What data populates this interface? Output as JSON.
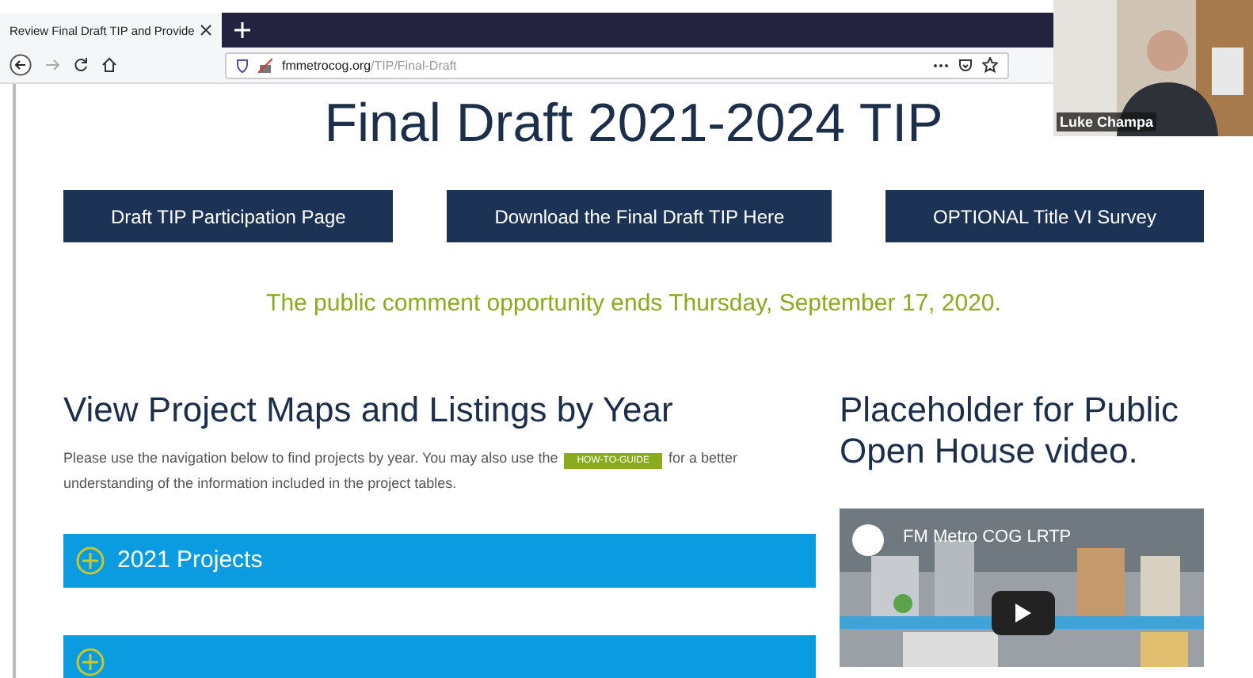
{
  "browser": {
    "tab_title": "Review Final Draft TIP and Provide",
    "url_host": "fmmetrocog.org",
    "url_path": "/TIP/Final-Draft"
  },
  "page": {
    "title": "Final Draft 2021-2024 TIP",
    "buttons": [
      "Draft TIP Participation Page",
      "Download the Final Draft TIP Here",
      "OPTIONAL Title VI Survey"
    ],
    "notice": "The public comment opportunity ends Thursday, September 17, 2020.",
    "listings": {
      "heading": "View Project Maps and Listings by Year",
      "text_before": "Please use the navigation below to find projects by year.  You may also use the",
      "guide_button": "HOW-TO-GUIDE",
      "text_after": "for a better understanding of the information included in the project tables.",
      "accordion": [
        {
          "label": "2021 Projects",
          "expanded": false
        },
        {
          "expanded": false
        }
      ]
    },
    "video_section": {
      "heading": "Placeholder for Public Open House video.",
      "video_title": "FM Metro COG LRTP",
      "kind": "picture"
    }
  },
  "participant": {
    "name": "Luke Champa"
  }
}
